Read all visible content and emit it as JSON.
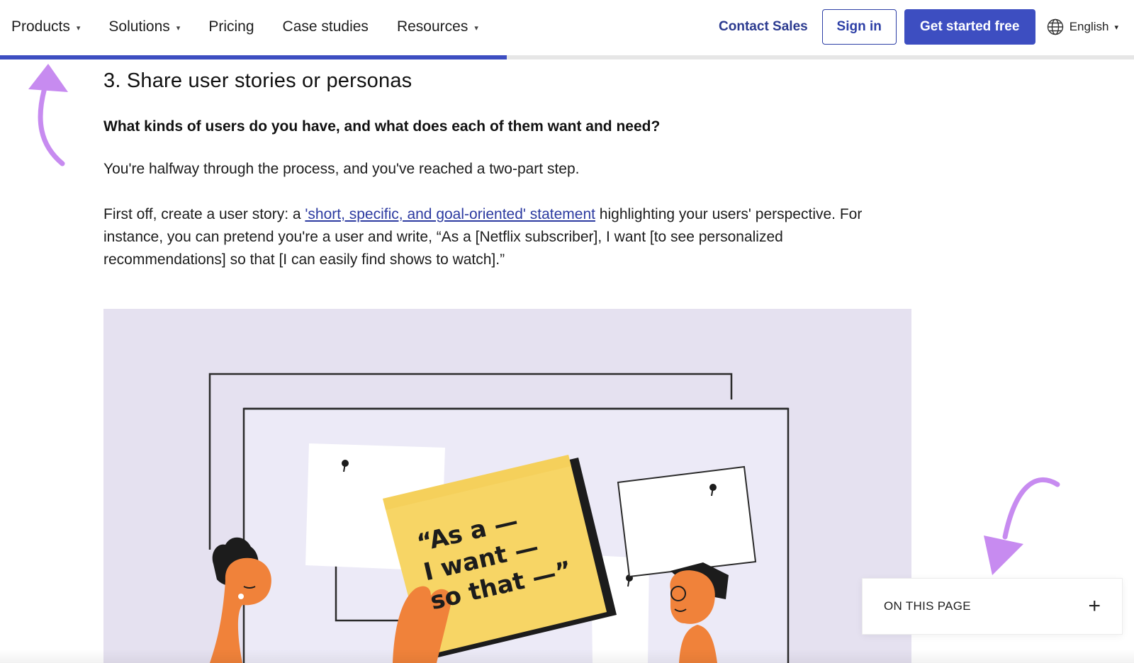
{
  "nav": {
    "items": [
      {
        "label": "Products",
        "has_dropdown": true
      },
      {
        "label": "Solutions",
        "has_dropdown": true
      },
      {
        "label": "Pricing",
        "has_dropdown": false
      },
      {
        "label": "Case studies",
        "has_dropdown": false
      },
      {
        "label": "Resources",
        "has_dropdown": true
      }
    ],
    "contact_sales": "Contact Sales",
    "sign_in": "Sign in",
    "get_started": "Get started free",
    "language": "English",
    "chevron": "⌄"
  },
  "reading_progress": 0.447,
  "article": {
    "heading": "3. Share user stories or personas",
    "lead": "What kinds of users do you have, and what does each of them want and need?",
    "para1": "You're halfway through the process, and you've reached a two-part step.",
    "para2_before": "First off, create a user story: a ",
    "para2_link": "'short, specific, and goal-oriented' statement",
    "para2_after": " highlighting your users' perspective. For instance, you can pretend you're a user and write, “As a [Netflix subscriber], I want [to see personalized recommendations] so that [I can easily find shows to watch].”"
  },
  "illustration": {
    "note_line1": "“As a —",
    "note_line2": "I want —",
    "note_line3": "so that —”"
  },
  "on_this_page": {
    "label": "ON THIS PAGE",
    "toggle": "+"
  },
  "colors": {
    "brand": "#3d4ec1",
    "link": "#2c3aa0",
    "arrow": "#c78bf0",
    "figure_bg": "#e5e1f0",
    "note_yellow": "#f7d565",
    "skin_orange": "#f0823a"
  },
  "icons": [
    "chevron-down-icon",
    "globe-icon",
    "arrow-icon",
    "plus-icon",
    "pin-icon"
  ]
}
